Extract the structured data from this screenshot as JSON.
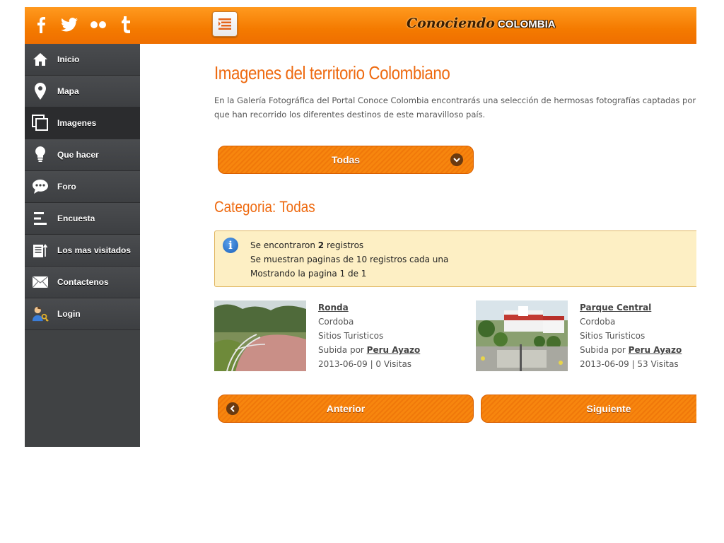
{
  "social": [
    {
      "icon": "facebook-icon"
    },
    {
      "icon": "twitter-icon"
    },
    {
      "icon": "flickr-icon"
    },
    {
      "icon": "tumblr-icon"
    }
  ],
  "logo": {
    "script": "Conociendo",
    "caps": "COLOMBIA"
  },
  "sidebar": {
    "items": [
      {
        "label": "Inicio",
        "icon": "home-icon"
      },
      {
        "label": "Mapa",
        "icon": "map-pin-icon"
      },
      {
        "label": "Imagenes",
        "icon": "gallery-icon",
        "active": true
      },
      {
        "label": "Que hacer",
        "icon": "lightbulb-icon"
      },
      {
        "label": "Foro",
        "icon": "chat-bubble-icon"
      },
      {
        "label": "Encuesta",
        "icon": "poll-icon"
      },
      {
        "label": "Los mas visitados",
        "icon": "most-visited-icon"
      },
      {
        "label": "Contactenos",
        "icon": "envelope-icon"
      },
      {
        "label": "Login",
        "icon": "user-key-icon"
      }
    ]
  },
  "main": {
    "title": "Imagenes del territorio Colombiano",
    "intro_line1": "En la Galería Fotográfica del Portal Conoce Colombia encontrarás una selección de hermosas fotografías captadas por los lentes d",
    "intro_line2": "que han recorrido los diferentes destinos de este maravilloso país.",
    "filter_label": "Todas",
    "category_title": "Categoria: Todas",
    "info": {
      "line1_pre": "Se encontraron ",
      "line1_count": "2",
      "line1_post": " registros",
      "line2": "Se muestran paginas de 10 registros cada una",
      "line3": "Mostrando la pagina 1 de 1"
    },
    "cards": [
      {
        "title": "Ronda",
        "location": "Cordoba",
        "category": "Sitios Turisticos",
        "uploaded_prefix": "Subida por ",
        "uploader": "Peru Ayazo",
        "date": "2013-06-09",
        "visits": "0 Visitas"
      },
      {
        "title": "Parque Central",
        "location": "Cordoba",
        "category": "Sitios Turisticos",
        "uploaded_prefix": "Subida por ",
        "uploader": "Peru Ayazo",
        "date": "2013-06-09",
        "visits": "53 Visitas"
      }
    ],
    "pagination": {
      "prev": "Anterior",
      "next": "Siguiente"
    }
  },
  "colors": {
    "accent": "#f7860e",
    "title": "#ee6a10",
    "sidebar": "#404244",
    "info_bg": "#fdefc4"
  }
}
